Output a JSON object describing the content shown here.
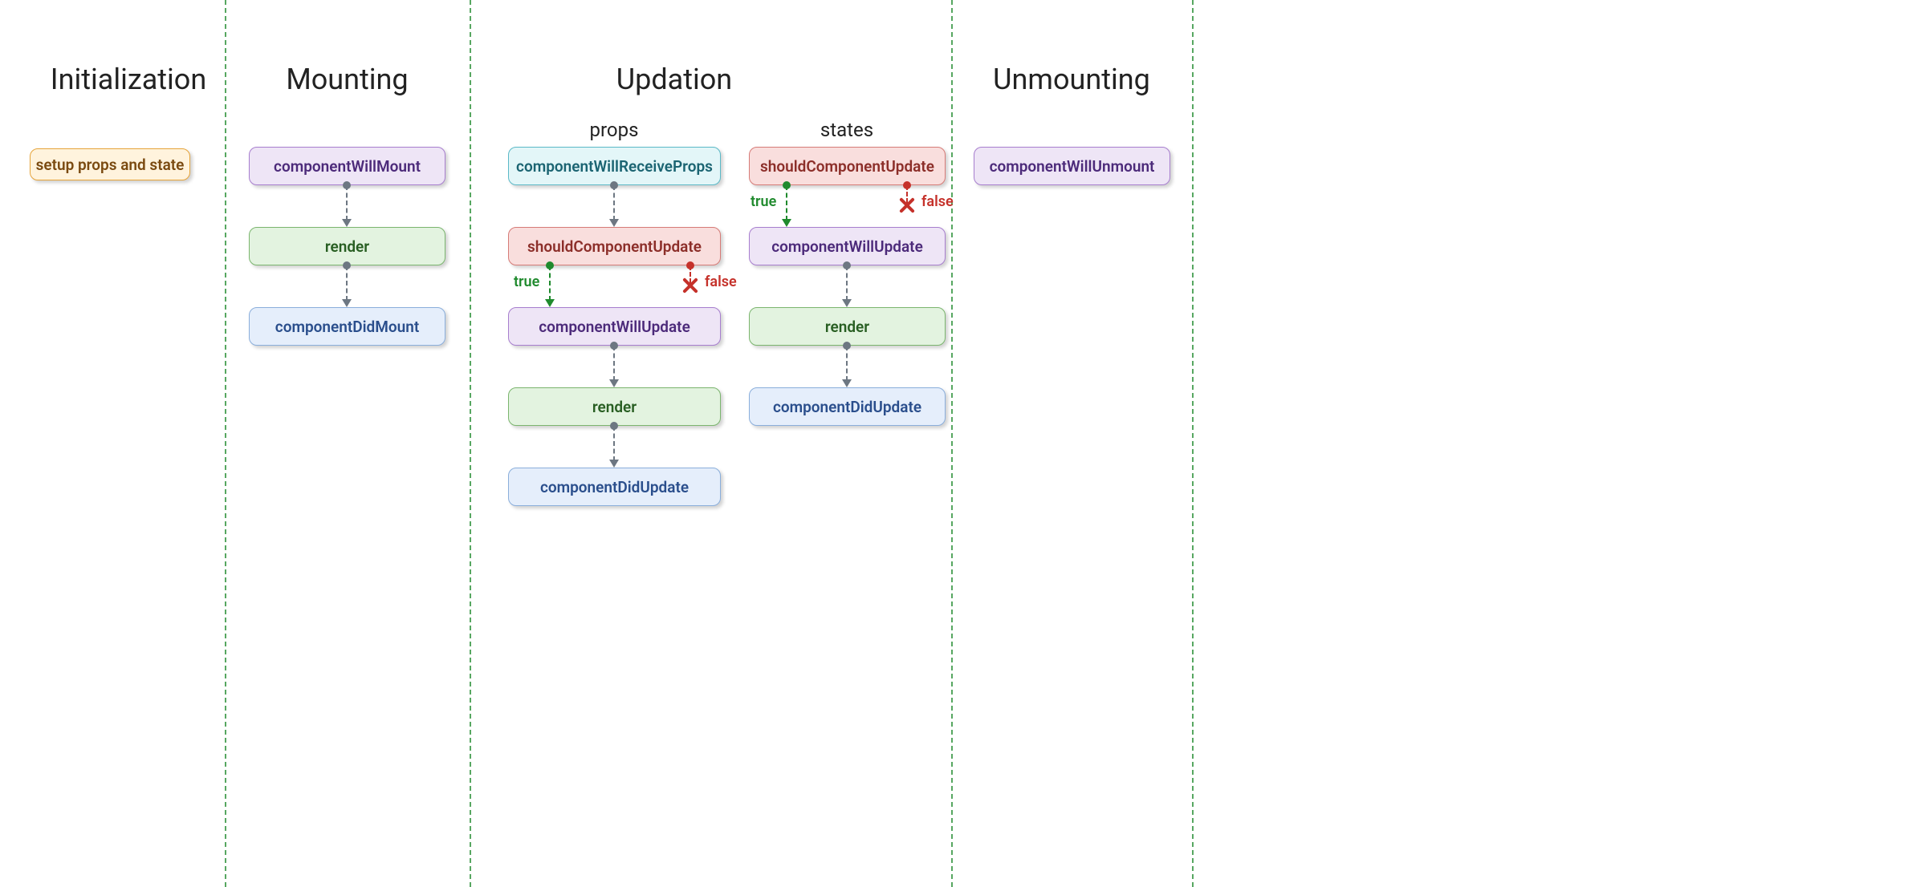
{
  "sections": {
    "initialization": "Initialization",
    "mounting": "Mounting",
    "updation": "Updation",
    "unmounting": "Unmounting"
  },
  "subheads": {
    "props": "props",
    "states": "states"
  },
  "labels": {
    "true": "true",
    "false": "false"
  },
  "nodes": {
    "init_setup": "setup props and state",
    "mount_will": "componentWillMount",
    "mount_render": "render",
    "mount_did": "componentDidMount",
    "upd_props_recv": "componentWillReceiveProps",
    "upd_props_should": "shouldComponentUpdate",
    "upd_props_will": "componentWillUpdate",
    "upd_props_render": "render",
    "upd_props_did": "componentDidUpdate",
    "upd_states_should": "shouldComponentUpdate",
    "upd_states_will": "componentWillUpdate",
    "upd_states_render": "render",
    "upd_states_did": "componentDidUpdate",
    "unmount_will": "componentWillUnmount"
  },
  "colors": {
    "accent_green": "#1f8a2d",
    "accent_red": "#c5312a",
    "node_orange_bg": "#fff3dd",
    "node_purple_bg": "#eee5f6",
    "node_green_bg": "#e3f3e0",
    "node_blue_bg": "#e5eefb",
    "node_cyan_bg": "#e3f6f8",
    "node_red_bg": "#f9dedd"
  }
}
